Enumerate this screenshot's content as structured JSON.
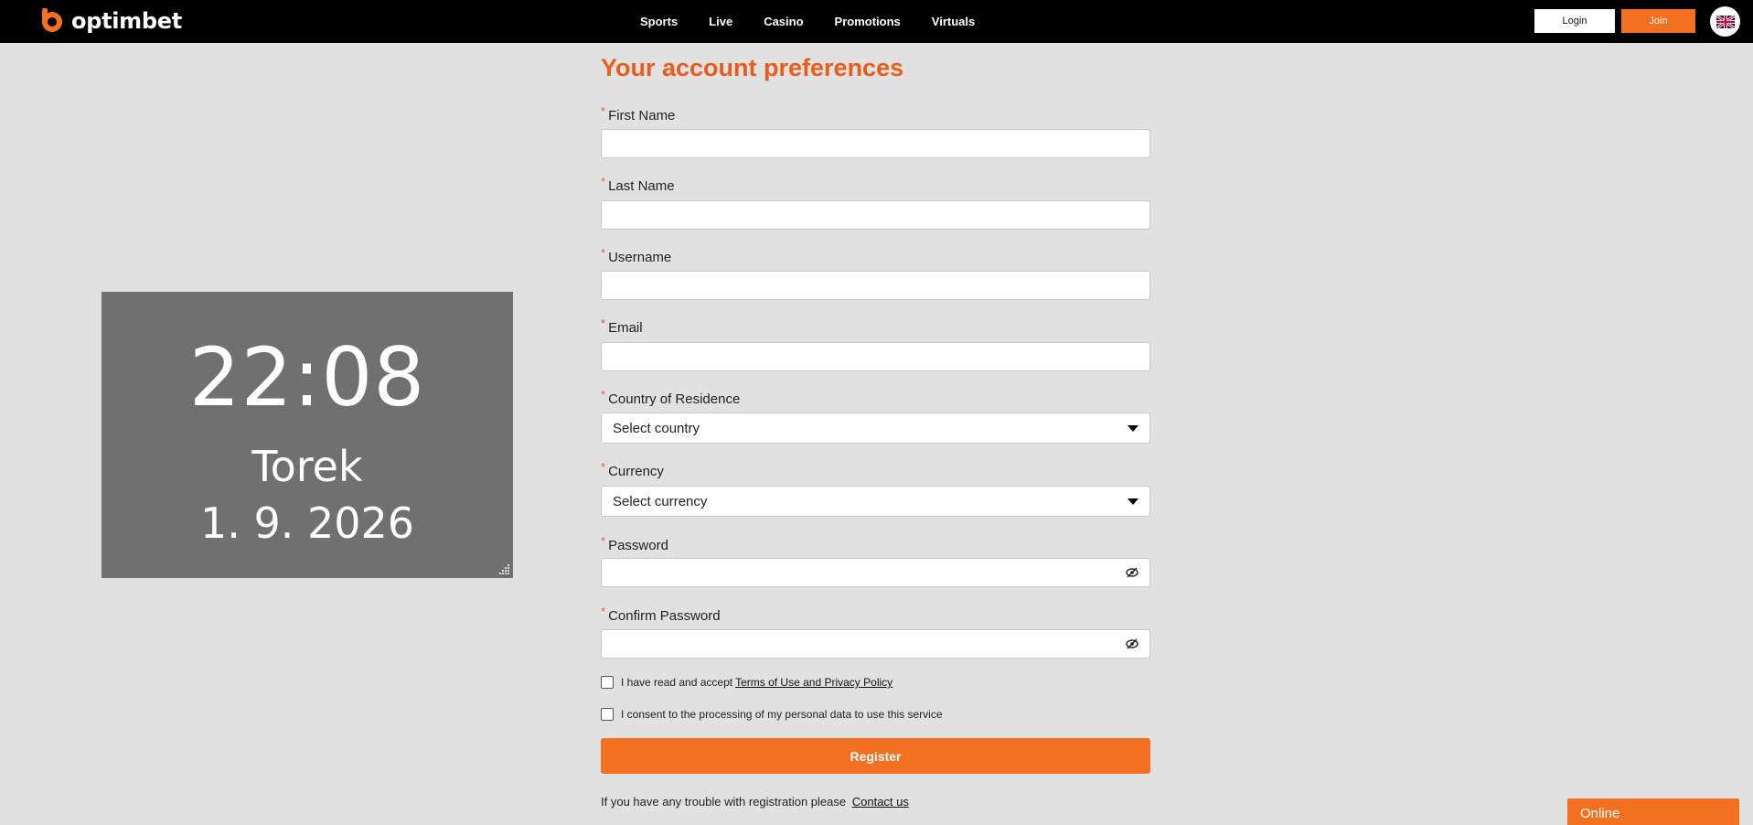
{
  "header": {
    "brand": "optimbet",
    "nav": [
      "Sports",
      "Live",
      "Casino",
      "Promotions",
      "Virtuals"
    ],
    "login_label": "Login",
    "join_label": "Join",
    "language_icon": "uk-flag-icon"
  },
  "clock": {
    "time": "22:08",
    "day": "Torek",
    "date": "1. 9. 2026"
  },
  "form": {
    "title": "Your account preferences",
    "required_mark": "*",
    "first_name_label": "First Name",
    "last_name_label": "Last Name",
    "username_label": "Username",
    "email_label": "Email",
    "country_label": "Country of Residence",
    "country_value": "Select country",
    "currency_label": "Currency",
    "currency_value": "Select currency",
    "password_label": "Password",
    "confirm_password_label": "Confirm Password",
    "terms_text": "I have read and accept",
    "terms_link": "Terms of Use and Privacy Policy",
    "consent_text": "I consent to the processing of my personal data to use this service",
    "register_label": "Register",
    "trouble_text": "If you have any trouble with registration please",
    "contact_link": "Contact us"
  },
  "chat": {
    "status": "Online"
  },
  "colors": {
    "accent": "#f47021",
    "title": "#e85d1b",
    "header_bg": "#000000",
    "page_bg": "#e1e1e1",
    "clock_bg": "#707070"
  }
}
